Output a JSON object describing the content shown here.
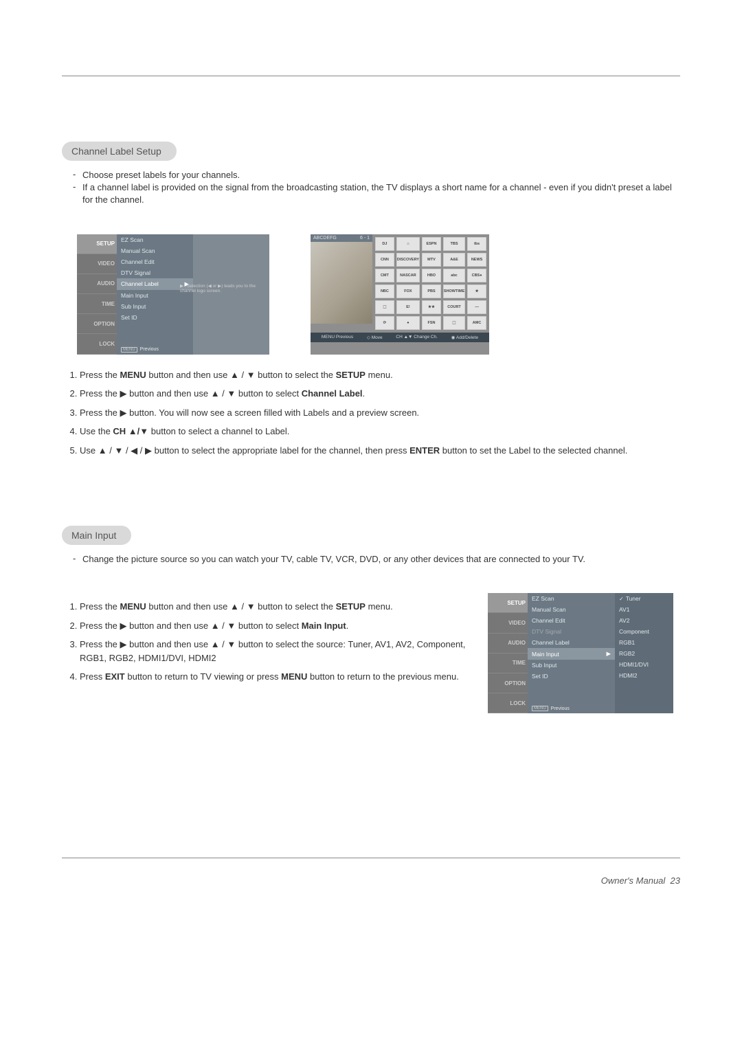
{
  "section1": {
    "title": "Channel Label Setup",
    "intro": [
      "Choose preset labels for your channels.",
      "If a channel label is provided on the signal from the broadcasting station, the TV displays a short name for a channel - even if you didn't preset a label for the channel."
    ],
    "steps": [
      {
        "pre": "Press the ",
        "b1": "MENU",
        "mid1": " button and then use ",
        "sym1": "▲",
        "slash1": " / ",
        "sym2": "▼",
        "mid2": "  button to select the ",
        "b2": "SETUP",
        "post": " menu."
      },
      {
        "pre": "Press the ",
        "sym1": "▶",
        "mid1": " button and then use ",
        "sym2": "▲",
        "slash1": " / ",
        "sym3": "▼",
        "mid2": " button to select ",
        "b1": "Channel Label",
        "post": "."
      },
      {
        "pre": "Press the ",
        "sym1": "▶",
        "post": " button. You will now see a screen filled with Labels and a preview screen."
      },
      {
        "pre": "Use the ",
        "b1": "CH ▲/▼",
        "post": " button to select a channel to Label."
      },
      {
        "pre": "Use ",
        "sym1": "▲",
        "slash1": " / ",
        "sym2": "▼",
        "slash2": " / ",
        "sym3": "◀",
        "slash3": " / ",
        "sym4": "▶",
        "mid1": " button to select the appropriate label for the channel, then press ",
        "b1": "ENTER",
        "post": " button to set the Label to the selected channel."
      }
    ]
  },
  "section2": {
    "title": "Main Input",
    "intro": [
      "Change the picture source so you can watch your TV, cable TV, VCR, DVD, or any other devices that are connected to your TV."
    ],
    "steps": [
      {
        "pre": "Press the ",
        "b1": "MENU",
        "mid1": " button and then use ",
        "sym1": "▲",
        "slash1": " / ",
        "sym2": "▼",
        "mid2": "  button to select the ",
        "b2": "SETUP",
        "post": " menu."
      },
      {
        "pre": "Press the ",
        "sym1": "▶",
        "mid1": " button and then use ",
        "sym2": "▲",
        "slash1": " / ",
        "sym3": "▼",
        "mid2": " button to select ",
        "b1": "Main Input",
        "post": "."
      },
      {
        "pre": "Press the ",
        "sym1": "▶",
        "mid1": " button and then use ",
        "sym2": "▲",
        "slash1": " / ",
        "sym3": "▼",
        "post": " button to select the source: Tuner, AV1, AV2, Component, RGB1, RGB2, HDMI1/DVI, HDMI2"
      },
      {
        "pre": "Press ",
        "b1": "EXIT",
        "mid1": " button to return to TV viewing or press ",
        "b2": "MENU",
        "post": " button to return to the previous menu."
      }
    ]
  },
  "osd": {
    "sidebar": [
      "SETUP",
      "VIDEO",
      "AUDIO",
      "TIME",
      "OPTION",
      "LOCK"
    ],
    "setup_menu": [
      "EZ Scan",
      "Manual Scan",
      "Channel Edit",
      "DTV Signal",
      "Channel Label",
      "Main Input",
      "Sub Input",
      "Set ID"
    ],
    "setup_menu_selected_1": "Channel Label",
    "setup_menu_selected_2": "Main Input",
    "setup_menu_dim_2": "DTV Signal",
    "hint": "Selection (◀ or ▶) leads you to the channel logo screen.",
    "footer_btn": "MENU",
    "footer_txt": "Previous",
    "input_list": [
      "Tuner",
      "AV1",
      "AV2",
      "Component",
      "RGB1",
      "RGB2",
      "HDMI1/DVI",
      "HDMI2"
    ],
    "input_checked": "Tuner"
  },
  "label_osd": {
    "preview_left": "ABCDEFG",
    "preview_right": "6 - 1",
    "logos": [
      "DJ",
      "⌂",
      "ESPN",
      "TBS",
      "tbs",
      "CNN",
      "DISCOVERY",
      "MTV",
      "A&E",
      "NEWS",
      "CMT",
      "NASCAR",
      "HBO",
      "abc",
      "CBS●",
      "NBC",
      "FOX",
      "PBS",
      "SHOWTIME",
      "★",
      "⬚",
      "E!",
      "★★",
      "COURT",
      "—",
      "⟳",
      "●",
      "FSN",
      "⬚",
      "AMC"
    ],
    "bottom": {
      "prev": "MENU Previous",
      "move": "◇ Move",
      "change": "CH ▲▼ Change Ch.",
      "add": "◉ Add/Delete"
    }
  },
  "footer": {
    "label": "Owner's Manual",
    "page": "23"
  }
}
